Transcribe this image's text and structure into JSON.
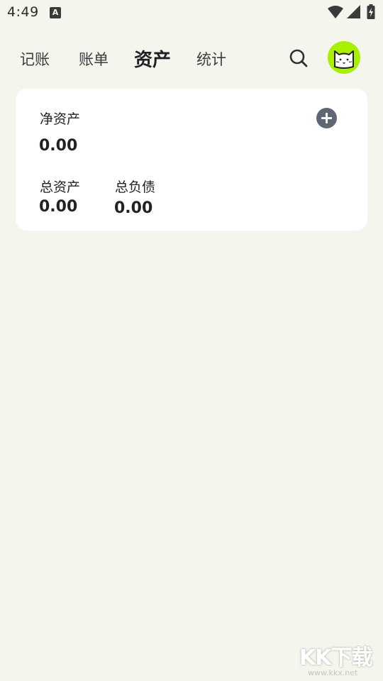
{
  "status_bar": {
    "time": "4:49",
    "notification_icon_letter": "A",
    "icons": [
      "wifi-icon",
      "signal-icon",
      "battery-icon"
    ]
  },
  "header": {
    "tabs": [
      {
        "label": "记账",
        "active": false
      },
      {
        "label": "账单",
        "active": false
      },
      {
        "label": "资产",
        "active": true
      },
      {
        "label": "统计",
        "active": false
      }
    ],
    "search_icon": "search-icon",
    "avatar_icon": "cat-avatar-icon",
    "avatar_color": "#a8f000"
  },
  "asset_card": {
    "net_assets_label": "净资产",
    "net_assets_value": "0.00",
    "add_icon": "plus-circle-icon",
    "total_assets_label": "总资产",
    "total_assets_value": "0.00",
    "total_liabilities_label": "总负债",
    "total_liabilities_value": "0.00"
  },
  "watermark": {
    "logo_text": "KK下载",
    "url": "www.kkx.net"
  },
  "colors": {
    "background": "#f4f5ec",
    "card": "#ffffff",
    "add_button": "#5f6775",
    "text_primary": "#1f2226"
  }
}
